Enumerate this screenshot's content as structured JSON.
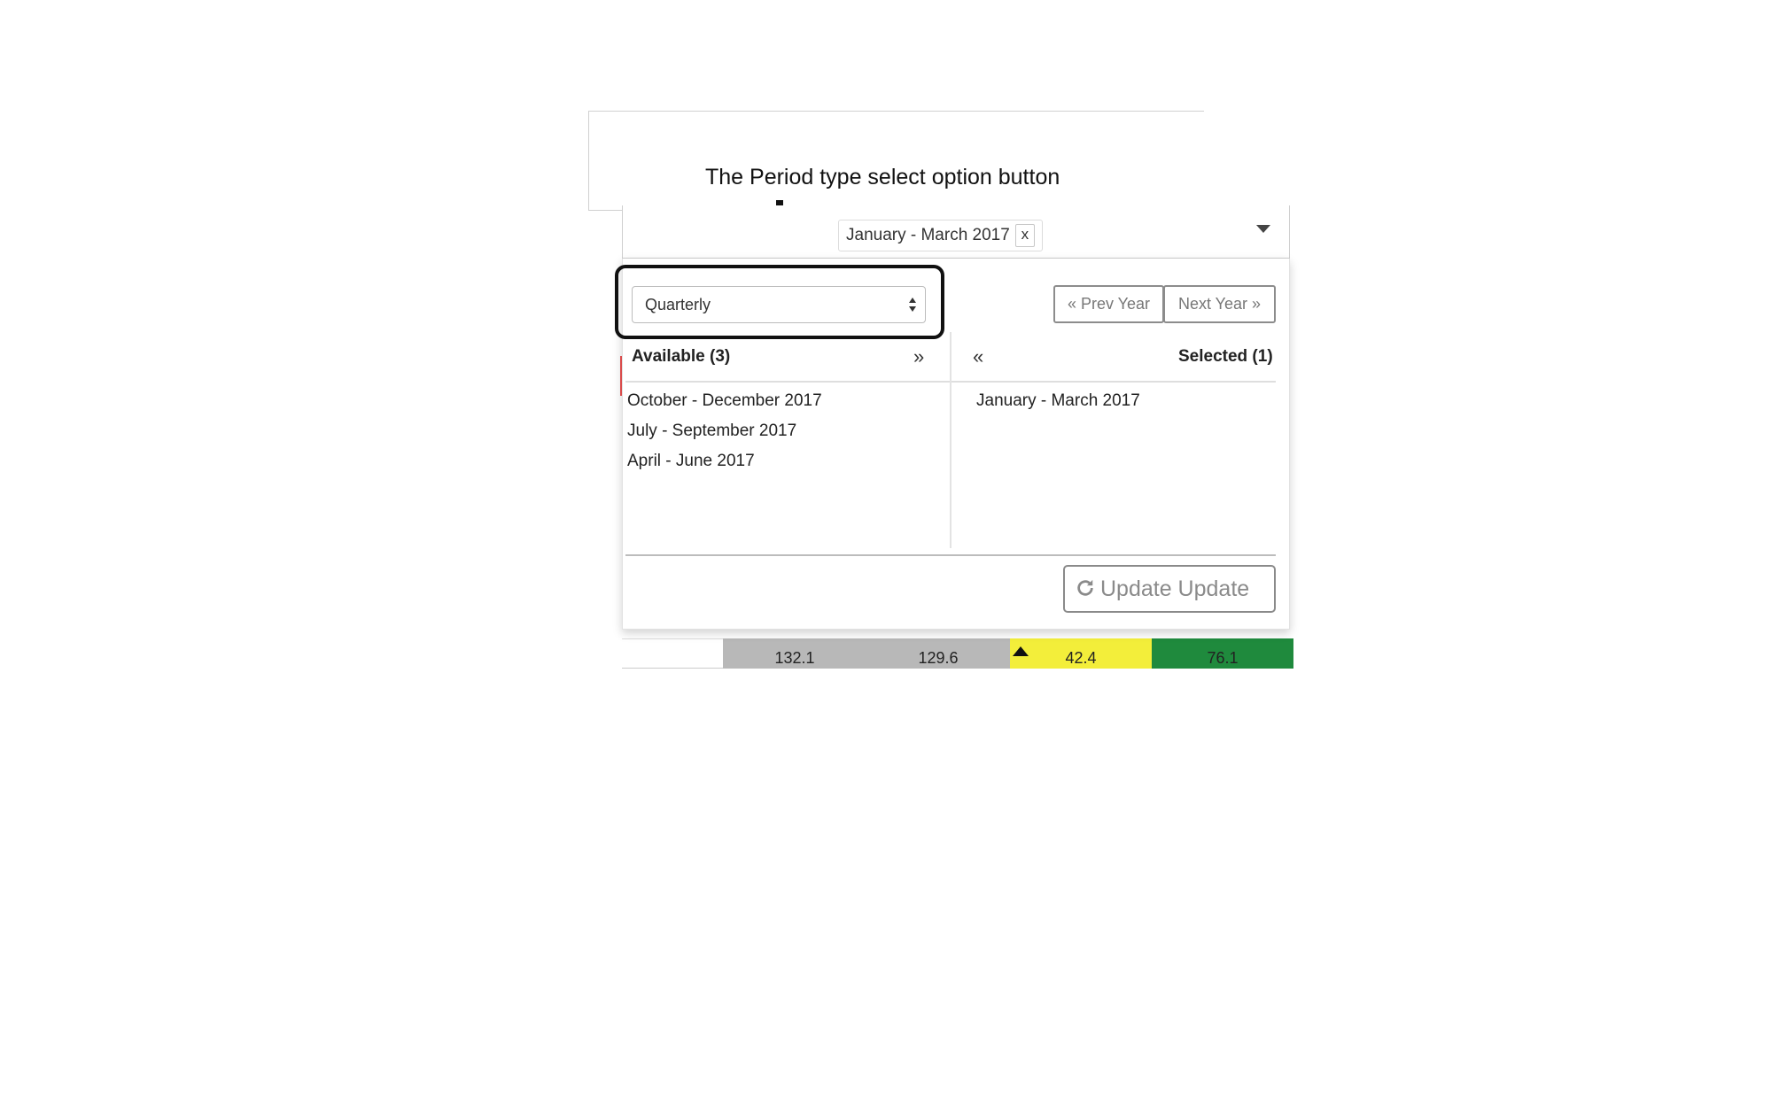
{
  "annotation": {
    "caption": "The Period type select option button"
  },
  "field": {
    "selected_chip": "January - March 2017",
    "chip_remove": "x"
  },
  "controls": {
    "period_type": "Quarterly",
    "prev_year": "« Prev Year",
    "next_year": "Next Year »"
  },
  "available": {
    "header": "Available (3)",
    "move_all": "»",
    "items": [
      "October - December 2017",
      "July - September 2017",
      "April - June 2017"
    ]
  },
  "selected": {
    "header": "Selected (1)",
    "remove_all": "«",
    "items": [
      "January - March 2017"
    ]
  },
  "actions": {
    "update": "Update Update"
  },
  "background_table": {
    "values": [
      "132.1",
      "129.6",
      "42.4",
      "76.1"
    ],
    "colors": {
      "gray": "#b8b8b8",
      "yellow": "#f3ee3a",
      "green": "#1f8a3d"
    }
  },
  "colors": {
    "border": "#8c8c8c",
    "highlight": "#111111"
  }
}
